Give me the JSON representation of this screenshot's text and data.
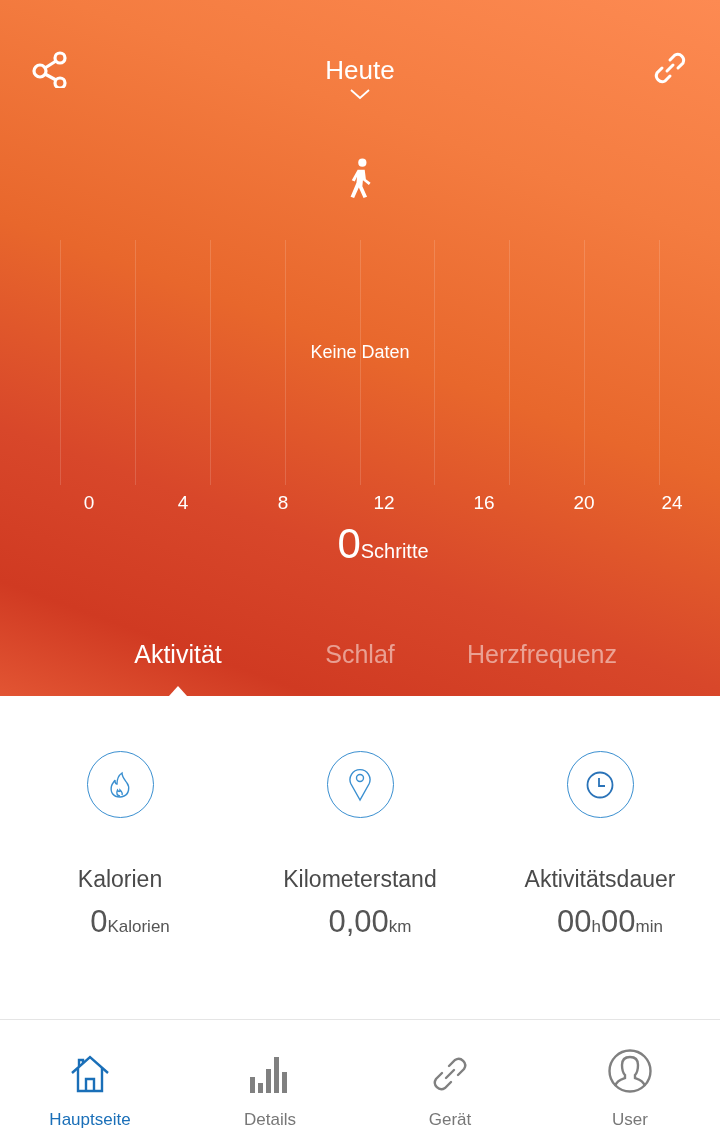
{
  "header": {
    "title": "Heute"
  },
  "chart": {
    "message": "Keine Daten",
    "x_labels": [
      "0",
      "4",
      "8",
      "12",
      "16",
      "20",
      "24"
    ]
  },
  "steps": {
    "value": "0",
    "unit": "Schritte"
  },
  "tabs": [
    {
      "label": "Aktivität",
      "selected": true
    },
    {
      "label": "Schlaf",
      "selected": false
    },
    {
      "label": "Herzfrequenz",
      "selected": false
    }
  ],
  "stats": [
    {
      "kind": "calories",
      "label": "Kalorien",
      "value": "0",
      "unit": "Kalorien"
    },
    {
      "kind": "distance",
      "label": "Kilometerstand",
      "value": "0,00",
      "unit": "km"
    },
    {
      "kind": "duration",
      "label": "Aktivitätsdauer",
      "value": "00",
      "unit": "h",
      "value2": "00",
      "unit2": "min"
    }
  ],
  "nav": [
    {
      "kind": "home",
      "label": "Hauptseite",
      "selected": true
    },
    {
      "kind": "details",
      "label": "Details",
      "selected": false
    },
    {
      "kind": "device",
      "label": "Gerät",
      "selected": false
    },
    {
      "kind": "user",
      "label": "User",
      "selected": false
    }
  ]
}
